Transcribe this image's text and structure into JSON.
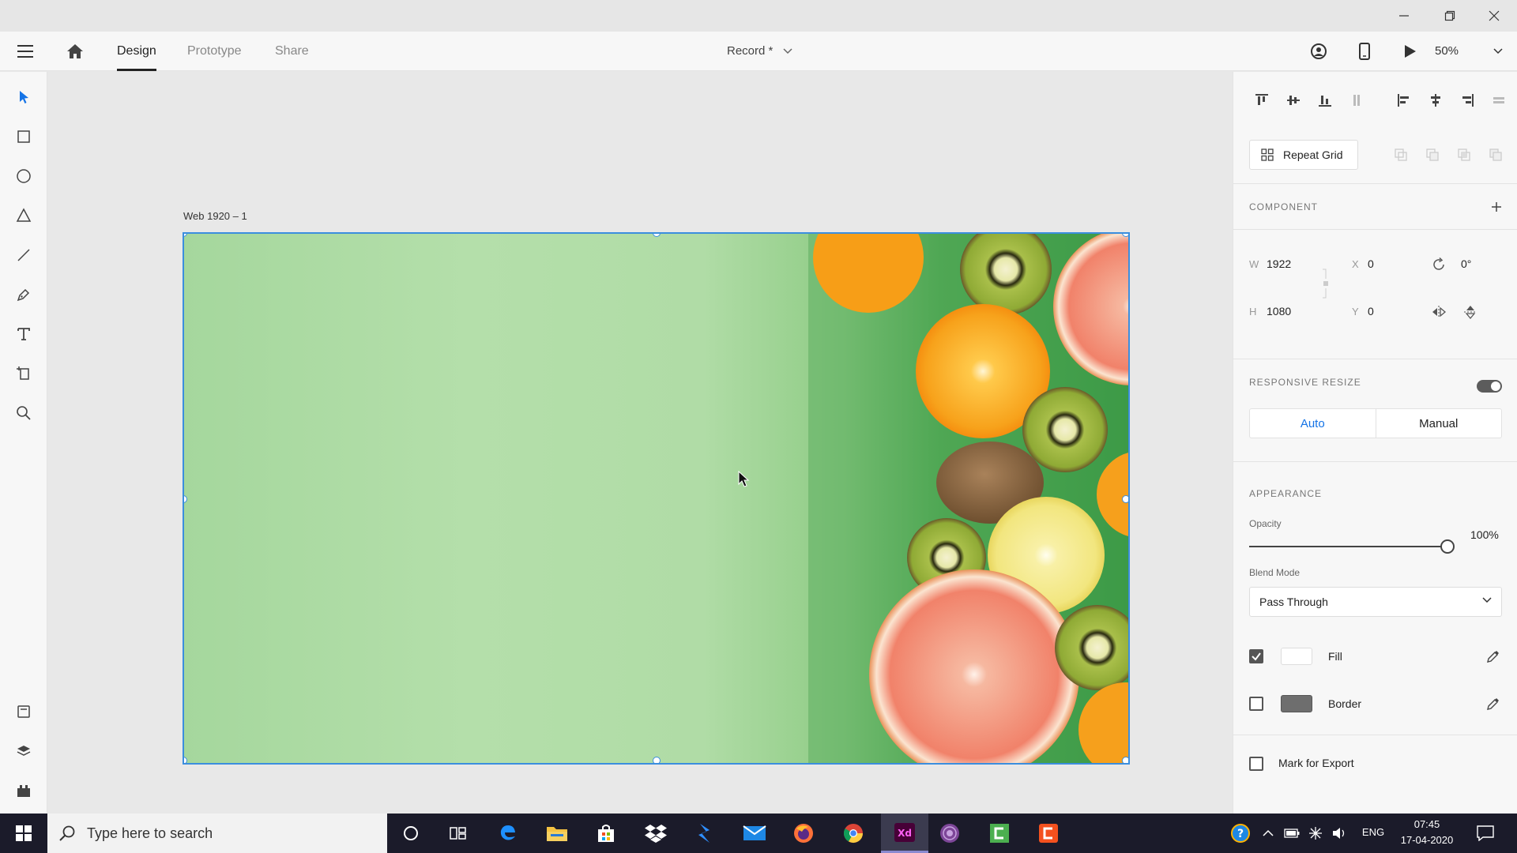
{
  "app": {
    "tabs": [
      {
        "label": "Design",
        "active": true
      },
      {
        "label": "Prototype",
        "active": false
      },
      {
        "label": "Share",
        "active": false
      }
    ],
    "document_title": "Record *",
    "zoom": "50%"
  },
  "canvas": {
    "artboard_label": "Web 1920 – 1"
  },
  "panel": {
    "repeat_grid_label": "Repeat Grid",
    "component_title": "COMPONENT",
    "dims": {
      "w_label": "W",
      "w_value": "1922",
      "h_label": "H",
      "h_value": "1080",
      "x_label": "X",
      "x_value": "0",
      "y_label": "Y",
      "y_value": "0",
      "rotation": "0°"
    },
    "responsive": {
      "title": "RESPONSIVE RESIZE",
      "enabled": true,
      "options": [
        "Auto",
        "Manual"
      ],
      "selected": "Auto"
    },
    "appearance": {
      "title": "APPEARANCE",
      "opacity_label": "Opacity",
      "opacity_value": "100%",
      "opacity": 1.0,
      "blend_label": "Blend Mode",
      "blend_value": "Pass Through",
      "fill_label": "Fill",
      "fill_checked": true,
      "fill_color": "#ffffff",
      "border_label": "Border",
      "border_checked": false,
      "border_color": "#6e6e6e"
    },
    "export_label": "Mark for Export"
  },
  "taskbar": {
    "search_placeholder": "Type here to search",
    "lang": "ENG",
    "time": "07:45",
    "date": "17-04-2020"
  },
  "colors": {
    "accent": "#1473e6",
    "selection": "#3b8ede"
  }
}
